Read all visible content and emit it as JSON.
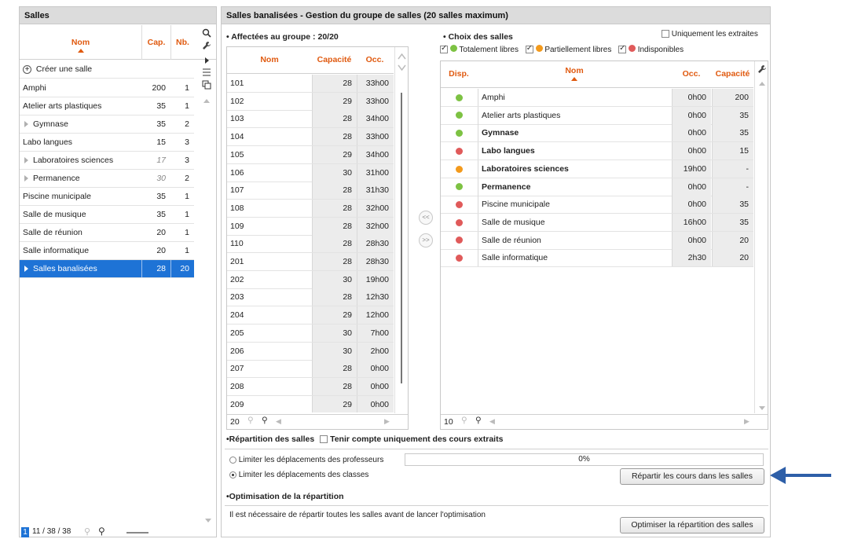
{
  "left_panel": {
    "title": "Salles",
    "columns": {
      "name": "Nom",
      "cap": "Cap.",
      "nb": "Nb."
    },
    "create_label": "Créer une salle",
    "rows": [
      {
        "name": "Amphi",
        "cap": "200",
        "nb": "1",
        "group": false,
        "italic": false,
        "selected": false
      },
      {
        "name": "Atelier arts plastiques",
        "cap": "35",
        "nb": "1",
        "group": false,
        "italic": false,
        "selected": false
      },
      {
        "name": "Gymnase",
        "cap": "35",
        "nb": "2",
        "group": true,
        "italic": false,
        "selected": false
      },
      {
        "name": "Labo langues",
        "cap": "15",
        "nb": "3",
        "group": false,
        "italic": false,
        "selected": false
      },
      {
        "name": "Laboratoires sciences",
        "cap": "17",
        "nb": "3",
        "group": true,
        "italic": true,
        "selected": false
      },
      {
        "name": "Permanence",
        "cap": "30",
        "nb": "2",
        "group": true,
        "italic": true,
        "selected": false
      },
      {
        "name": "Piscine municipale",
        "cap": "35",
        "nb": "1",
        "group": false,
        "italic": false,
        "selected": false
      },
      {
        "name": "Salle de musique",
        "cap": "35",
        "nb": "1",
        "group": false,
        "italic": false,
        "selected": false
      },
      {
        "name": "Salle de réunion",
        "cap": "20",
        "nb": "1",
        "group": false,
        "italic": false,
        "selected": false
      },
      {
        "name": "Salle informatique",
        "cap": "20",
        "nb": "1",
        "group": false,
        "italic": false,
        "selected": false
      },
      {
        "name": "Salles banalisées",
        "cap": "28",
        "nb": "20",
        "group": true,
        "italic": false,
        "selected": true
      }
    ],
    "footer": {
      "page": "1",
      "count": "11 / 38 / 38"
    }
  },
  "main": {
    "title": "Salles banalisées - Gestion du groupe de salles (20 salles maximum)",
    "assigned": {
      "title": "• Affectées au groupe : 20/20",
      "columns": {
        "name": "Nom",
        "cap": "Capacité",
        "occ": "Occ."
      },
      "rows": [
        {
          "name": "101",
          "cap": "28",
          "occ": "33h00"
        },
        {
          "name": "102",
          "cap": "29",
          "occ": "33h00"
        },
        {
          "name": "103",
          "cap": "28",
          "occ": "34h00"
        },
        {
          "name": "104",
          "cap": "28",
          "occ": "33h00"
        },
        {
          "name": "105",
          "cap": "29",
          "occ": "34h00"
        },
        {
          "name": "106",
          "cap": "30",
          "occ": "31h00"
        },
        {
          "name": "107",
          "cap": "28",
          "occ": "31h30"
        },
        {
          "name": "108",
          "cap": "28",
          "occ": "32h00"
        },
        {
          "name": "109",
          "cap": "28",
          "occ": "32h00"
        },
        {
          "name": "110",
          "cap": "28",
          "occ": "28h30"
        },
        {
          "name": "201",
          "cap": "28",
          "occ": "28h30"
        },
        {
          "name": "202",
          "cap": "30",
          "occ": "19h00"
        },
        {
          "name": "203",
          "cap": "28",
          "occ": "12h30"
        },
        {
          "name": "204",
          "cap": "29",
          "occ": "12h00"
        },
        {
          "name": "205",
          "cap": "30",
          "occ": "7h00"
        },
        {
          "name": "206",
          "cap": "30",
          "occ": "2h00"
        },
        {
          "name": "207",
          "cap": "28",
          "occ": "0h00"
        },
        {
          "name": "208",
          "cap": "28",
          "occ": "0h00"
        },
        {
          "name": "209",
          "cap": "29",
          "occ": "0h00"
        }
      ],
      "footer_count": "20"
    },
    "transfer": {
      "left": "<<",
      "right": ">>"
    },
    "choice": {
      "title": "• Choix des salles",
      "only_extracted": "Uniquement les extraites",
      "filters": {
        "free": "Totalement libres",
        "partial": "Partiellement libres",
        "unavailable": "Indisponibles"
      },
      "columns": {
        "disp": "Disp.",
        "name": "Nom",
        "occ": "Occ.",
        "cap": "Capacité"
      },
      "rows": [
        {
          "status": "free",
          "name": "Amphi",
          "occ": "0h00",
          "cap": "200",
          "bold": false
        },
        {
          "status": "free",
          "name": "Atelier arts plastiques",
          "occ": "0h00",
          "cap": "35",
          "bold": false
        },
        {
          "status": "free",
          "name": "Gymnase",
          "occ": "0h00",
          "cap": "35",
          "bold": true
        },
        {
          "status": "unavailable",
          "name": "Labo langues",
          "occ": "0h00",
          "cap": "15",
          "bold": true
        },
        {
          "status": "partial",
          "name": "Laboratoires sciences",
          "occ": "19h00",
          "cap": "-",
          "bold": true
        },
        {
          "status": "free",
          "name": "Permanence",
          "occ": "0h00",
          "cap": "-",
          "bold": true
        },
        {
          "status": "unavailable",
          "name": "Piscine municipale",
          "occ": "0h00",
          "cap": "35",
          "bold": false
        },
        {
          "status": "unavailable",
          "name": "Salle de musique",
          "occ": "16h00",
          "cap": "35",
          "bold": false
        },
        {
          "status": "unavailable",
          "name": "Salle de réunion",
          "occ": "0h00",
          "cap": "20",
          "bold": false
        },
        {
          "status": "unavailable",
          "name": "Salle informatique",
          "occ": "2h30",
          "cap": "20",
          "bold": false
        }
      ],
      "footer_count": "10"
    },
    "repartition": {
      "title": "•Répartition des salles",
      "only_extracted": "Tenir compte uniquement des cours extraits",
      "option_teachers": "Limiter les déplacements des professeurs",
      "option_classes": "Limiter les déplacements des classes",
      "progress_text": "0%",
      "progress": 0,
      "button": "Répartir les cours dans les salles"
    },
    "optimisation": {
      "title": "•Optimisation de la répartition",
      "message": "Il est nécessaire de répartir toutes les salles avant de lancer l'optimisation",
      "button": "Optimiser la répartition des salles"
    }
  },
  "colors": {
    "free": "#7dc243",
    "partial": "#f39a1c",
    "unavailable": "#e05a5a",
    "selected": "#1e73d6",
    "accent": "#e05a10",
    "arrow": "#2e5fa8"
  }
}
